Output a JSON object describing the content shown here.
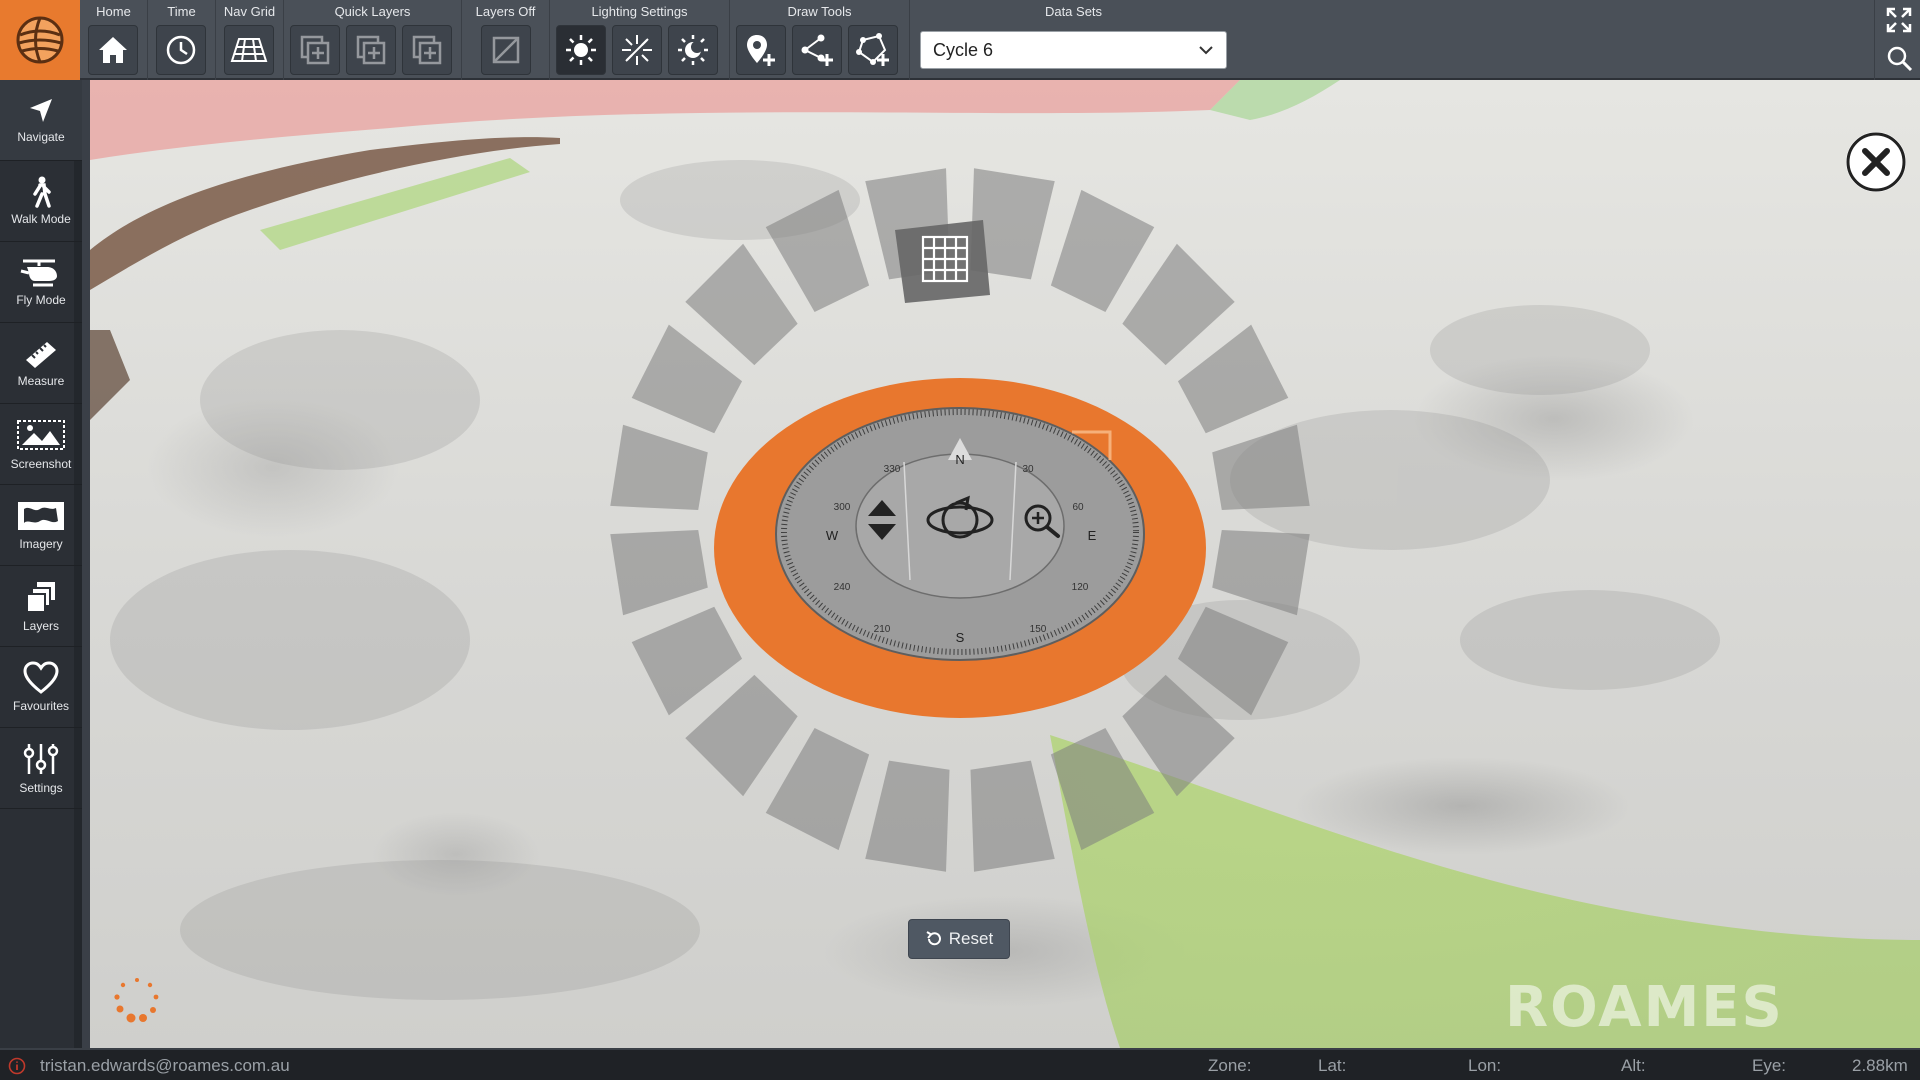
{
  "toolbar": {
    "groups": {
      "home": "Home",
      "time": "Time",
      "nav_grid": "Nav Grid",
      "quick_layers": "Quick Layers",
      "layers_off": "Layers Off",
      "lighting_settings": "Lighting Settings",
      "draw_tools": "Draw Tools",
      "data_sets": "Data Sets"
    },
    "dataset_selected": "Cycle 6"
  },
  "sidebar": {
    "items": [
      {
        "label": "Navigate",
        "icon": "navigate-arrow-icon"
      },
      {
        "label": "Walk Mode",
        "icon": "walk-icon"
      },
      {
        "label": "Fly Mode",
        "icon": "helicopter-icon"
      },
      {
        "label": "Measure",
        "icon": "ruler-icon"
      },
      {
        "label": "Screenshot",
        "icon": "screenshot-icon"
      },
      {
        "label": "Imagery",
        "icon": "imagery-map-icon"
      },
      {
        "label": "Layers",
        "icon": "layers-icon"
      },
      {
        "label": "Favourites",
        "icon": "heart-icon"
      },
      {
        "label": "Settings",
        "icon": "sliders-icon"
      }
    ]
  },
  "compass": {
    "cardinals": {
      "n": "N",
      "e": "E",
      "s": "S",
      "w": "W"
    },
    "degrees": [
      "30",
      "60",
      "120",
      "150",
      "210",
      "240",
      "300",
      "330"
    ],
    "accent_color": "#e8772e"
  },
  "reset_label": "Reset",
  "status": {
    "user_email": "tristan.edwards@roames.com.au",
    "zone_label": "Zone:",
    "lat_label": "Lat:",
    "lon_label": "Lon:",
    "alt_label": "Alt:",
    "eye_label": "Eye:",
    "eye_value": "2.88km"
  },
  "watermark": "ROAMES",
  "colors": {
    "accent": "#e87a2e",
    "toolbar_bg": "#4a5058",
    "sidebar_bg": "#2b2f35"
  }
}
